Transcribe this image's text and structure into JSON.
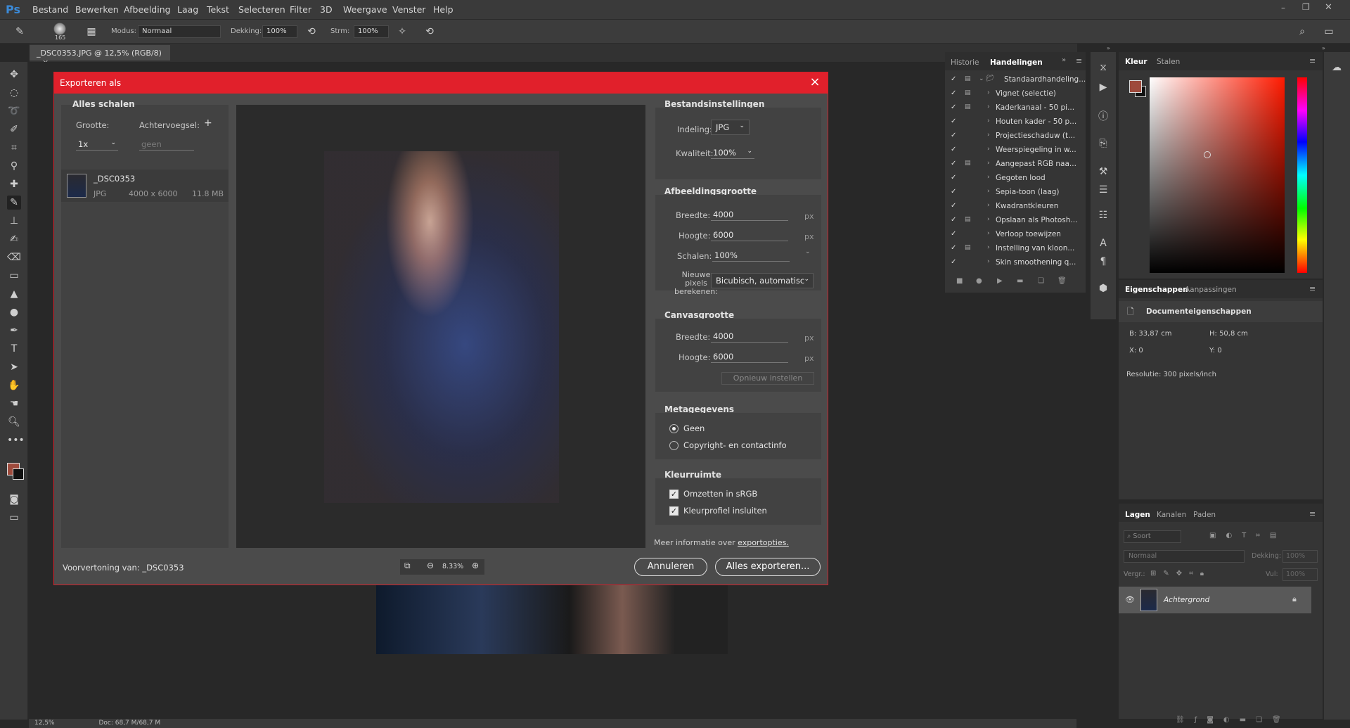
{
  "app": {
    "logo": "Ps"
  },
  "menu": [
    "Bestand",
    "Bewerken",
    "Afbeelding",
    "Laag",
    "Tekst",
    "Selecteren",
    "Filter",
    "3D",
    "Weergave",
    "Venster",
    "Help"
  ],
  "options": {
    "brush_size": "165",
    "mode_label": "Modus:",
    "mode_value": "Normaal",
    "opacity_label": "Dekking:",
    "opacity_value": "100%",
    "flow_label": "Strm:",
    "flow_value": "100%"
  },
  "document_tab": "_DSC0353.JPG @ 12,5% (RGB/8)",
  "status": {
    "zoom": "12,5%",
    "doc": "Doc: 68,7 M/68,7 M"
  },
  "dialog": {
    "title": "Exporteren als",
    "scale_all": {
      "title": "Alles schalen",
      "size_label": "Grootte:",
      "suffix_label": "Achtervoegsel:",
      "size_value": "1x",
      "suffix_placeholder": "geen"
    },
    "asset": {
      "name": "_DSC0353",
      "format": "JPG",
      "dims": "4000 x 6000",
      "filesize": "11.8 MB"
    },
    "preview_label": "Voorvertoning van: _DSC0353",
    "zoom": "8.33%",
    "file_settings": {
      "title": "Bestandsinstellingen",
      "format_label": "Indeling:",
      "format_value": "JPG",
      "quality_label": "Kwaliteit:",
      "quality_value": "100%"
    },
    "image_size": {
      "title": "Afbeeldingsgrootte",
      "width_label": "Breedte:",
      "width_value": "4000",
      "height_label": "Hoogte:",
      "height_value": "6000",
      "scale_label": "Schalen:",
      "scale_value": "100%",
      "resample_label": "Nieuwe pixels berekenen:",
      "resample_value": "Bicubisch, automatisc",
      "unit": "px"
    },
    "canvas_size": {
      "title": "Canvasgrootte",
      "width_label": "Breedte:",
      "width_value": "4000",
      "height_label": "Hoogte:",
      "height_value": "6000",
      "reset_label": "Opnieuw instellen",
      "unit": "px"
    },
    "metadata": {
      "title": "Metagegevens",
      "opt_none": "Geen",
      "opt_copyright": "Copyright- en contactinfo"
    },
    "colorspace": {
      "title": "Kleurruimte",
      "srgb": "Omzetten in sRGB",
      "embed": "Kleurprofiel insluiten"
    },
    "more_info": "Meer informatie over",
    "more_info_link": "exportopties.",
    "cancel": "Annuleren",
    "export_all": "Alles exporteren..."
  },
  "history_panel": {
    "tabs": [
      "Historie",
      "Handelingen"
    ],
    "actions": [
      "Standaardhandeling...",
      "Vignet (selectie)",
      "Kaderkanaal - 50 pi...",
      "Houten kader - 50 p...",
      "Projectieschaduw (t...",
      "Weerspiegeling in w...",
      "Aangepast RGB naa...",
      "Gegoten lood",
      "Sepia-toon (laag)",
      "Kwadrantkleuren",
      "Opslaan als Photosh...",
      "Verloop toewijzen",
      "Instelling van kloon...",
      "Skin smoothening q..."
    ]
  },
  "color_panel": {
    "tabs": [
      "Kleur",
      "Stalen"
    ],
    "fg": "#9e4a3c",
    "bg": "#111111"
  },
  "properties_panel": {
    "tabs": [
      "Eigenschappen",
      "Aanpassingen"
    ],
    "title": "Documenteigenschappen",
    "b": "B:  33,87 cm",
    "h": "H:  50,8 cm",
    "x": "X:  0",
    "y": "Y:  0",
    "resolution": "Resolutie: 300 pixels/inch"
  },
  "layers_panel": {
    "tabs": [
      "Lagen",
      "Kanalen",
      "Paden"
    ],
    "kind": "Soort",
    "blend": "Normaal",
    "opacity_label": "Dekking:",
    "opacity_value": "100%",
    "lock_label": "Vergr.:",
    "fill_label": "Vul:",
    "fill_value": "100%",
    "layer_name": "Achtergrond"
  }
}
